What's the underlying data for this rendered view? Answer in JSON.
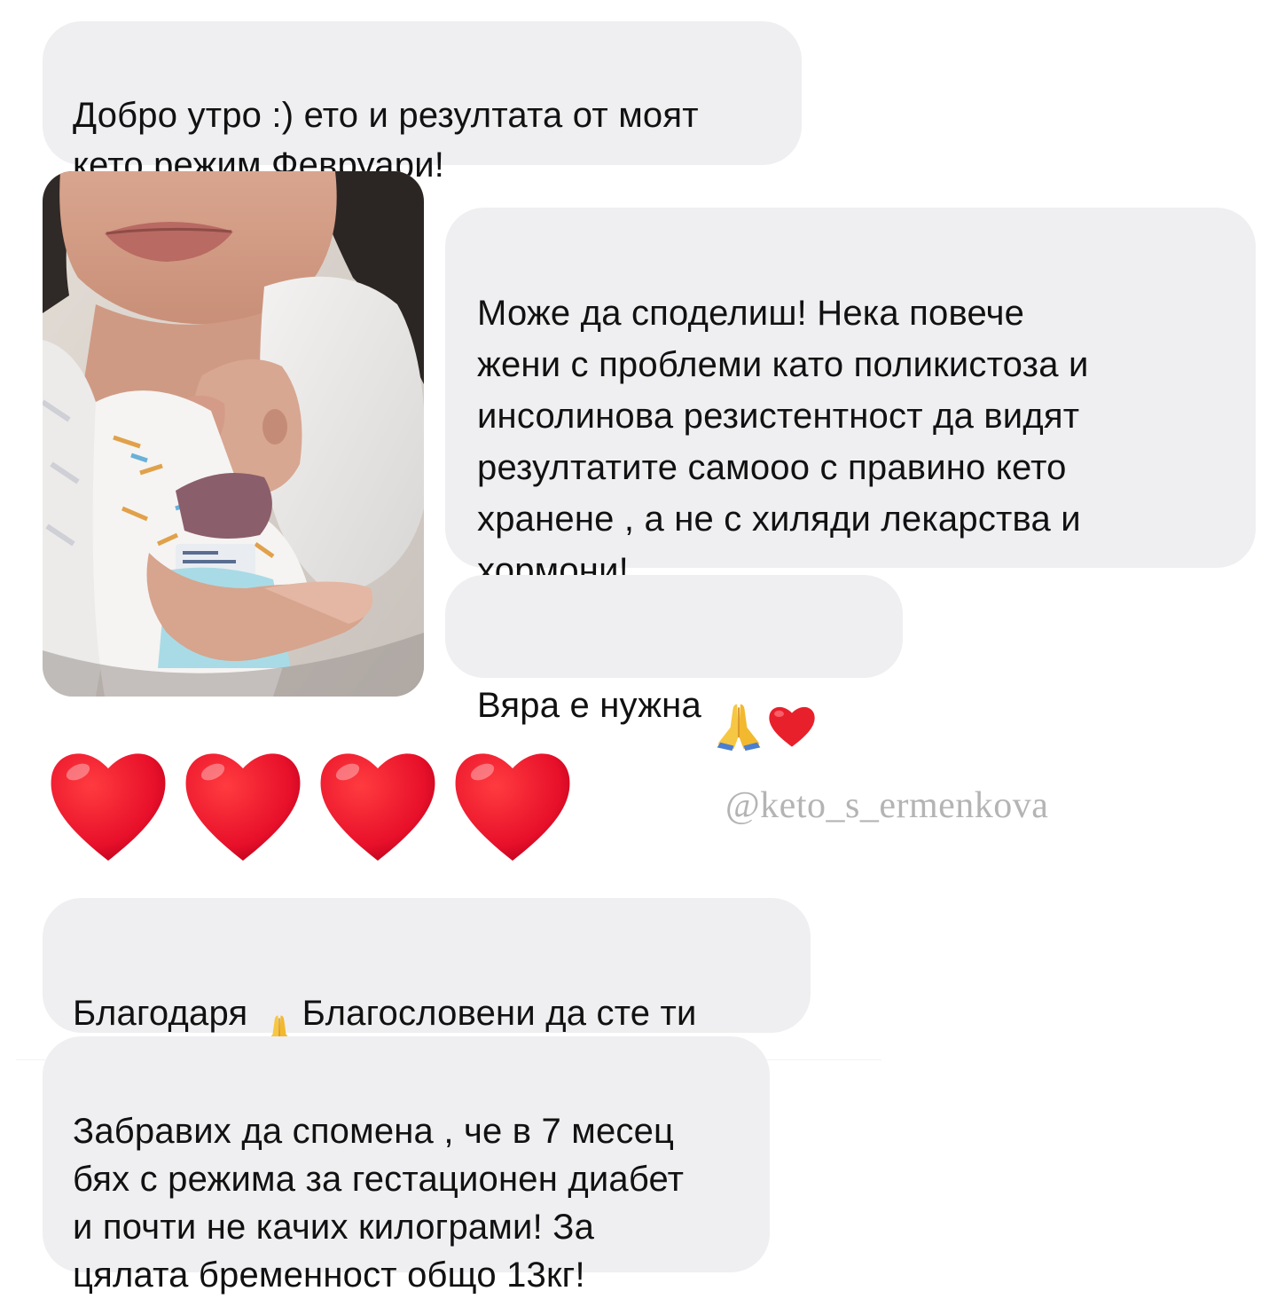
{
  "thread": {
    "msg1": "Добро утро :) ето и резултата от моят\nкето режим Февруари!",
    "msg2": "Може да споделиш! Нека повече\nжени с проблеми като поликистоза и\nинсолинова резистентност да видят\nрезултатите самооо с правино кето\nхранене , а не с хиляди лекарства и\nхормони!",
    "msg3_text": "Вяра е нужна ",
    "msg4_part1": "Благодаря ",
    "msg4_part2": "Благословени  да сте ти\nи цялото ти семейство",
    "msg5": "Забравих да спомена , че в 7 месец\nбях с режима за гестационен диабет\nи почти не качих килограми! За\nцялата бременност общо 13кг!"
  },
  "reactions": {
    "hearts_icon": "red-heart-icon",
    "hearts_count": 4,
    "pray_icon": "folded-hands-icon"
  },
  "watermark": "@keto_s_ermenkova",
  "colors": {
    "bubble": "#efeff1",
    "heart": "#e8202b",
    "watermark": "#b4b4b4"
  }
}
